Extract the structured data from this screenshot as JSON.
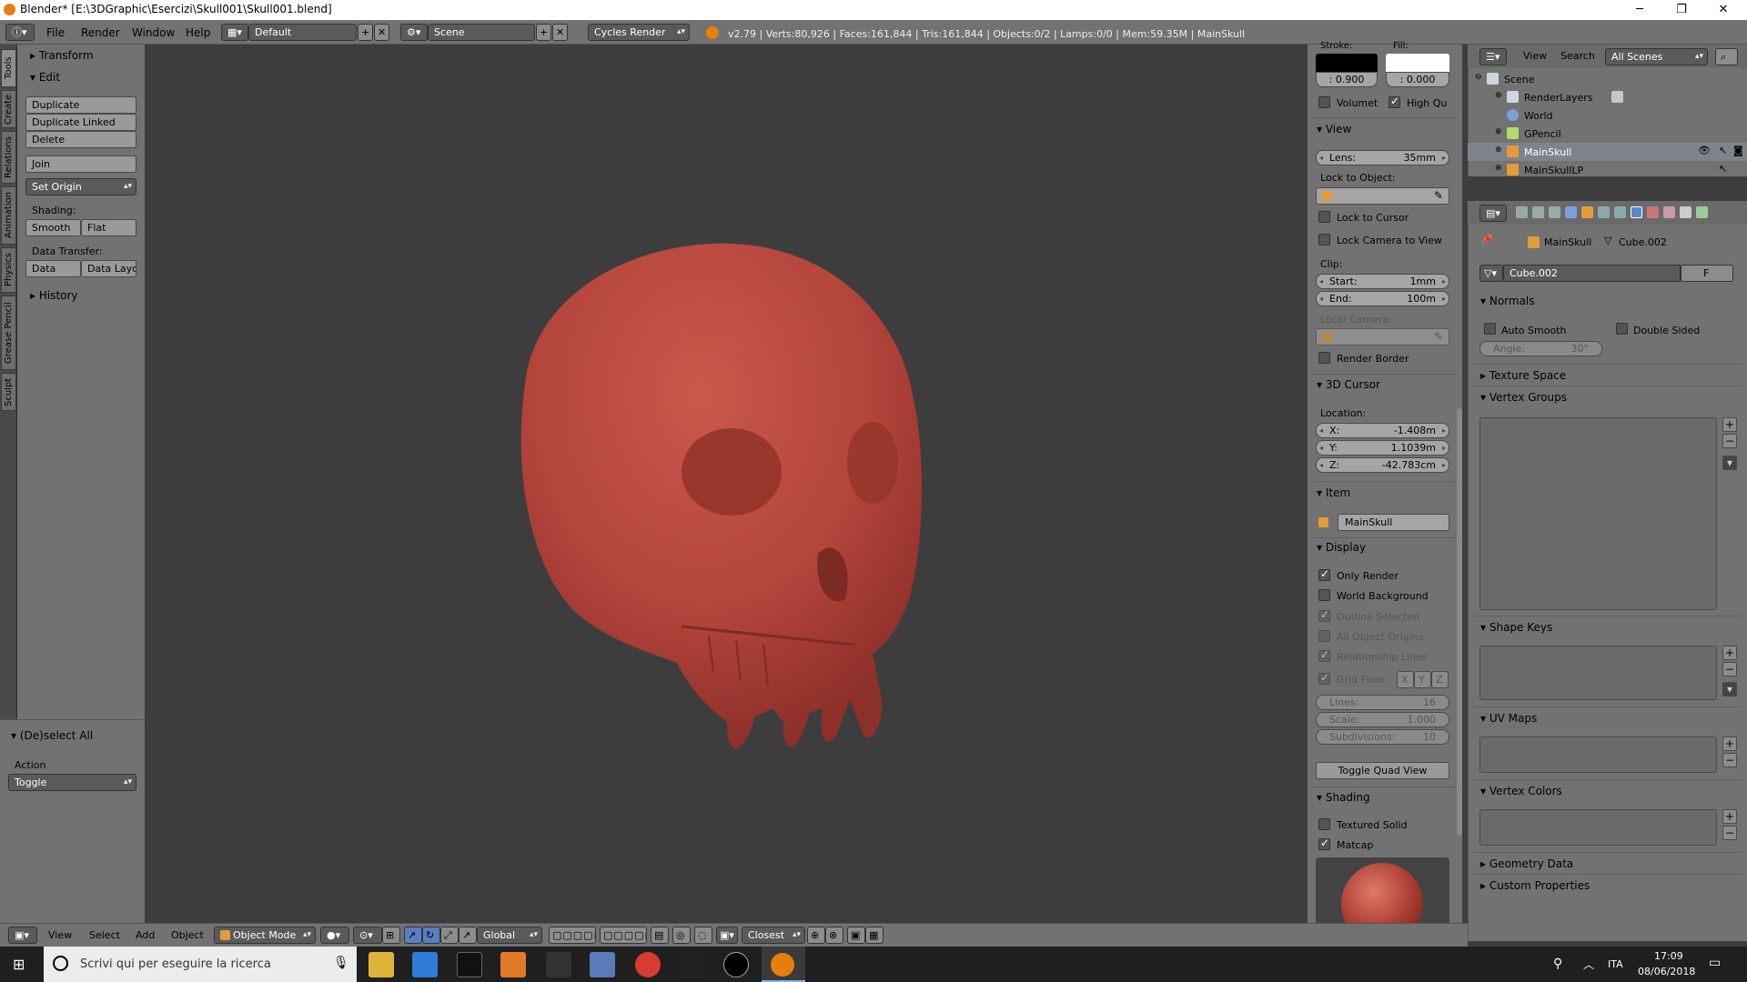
{
  "titlebar": {
    "title": "Blender* [E:\\3DGraphic\\Esercizi\\Skull001\\Skull001.blend]",
    "minimize": "─",
    "maximize": "❐",
    "close": "✕"
  },
  "menubar": {
    "items": [
      "File",
      "Render",
      "Window",
      "Help"
    ],
    "layout": "Default",
    "scene": "Scene",
    "engine": "Cycles Render",
    "stats": "v2.79 | Verts:80,926 | Faces:161,844 | Tris:161,844 | Objects:0/2 | Lamps:0/0 | Mem:59.35M | MainSkull"
  },
  "left_tabs": [
    "Tools",
    "Create",
    "Relations",
    "Animation",
    "Physics",
    "Grease Pencil",
    "Sculpt"
  ],
  "toolshelf": {
    "transform": "Transform",
    "edit": "Edit",
    "duplicate": "Duplicate",
    "duplicate_linked": "Duplicate Linked",
    "delete": "Delete",
    "join": "Join",
    "set_origin": "Set Origin",
    "shading_label": "Shading:",
    "smooth": "Smooth",
    "flat": "Flat",
    "data_transfer_label": "Data Transfer:",
    "data": "Data",
    "data_layo": "Data Layo",
    "history": "History"
  },
  "last_operator": {
    "title": "(De)select All",
    "action_label": "Action",
    "action_value": "Toggle"
  },
  "npanel": {
    "stroke_label": "Stroke:",
    "fill_label": "Fill:",
    "stroke_val": ": 0.900",
    "fill_val": ": 0.000",
    "volumet": "Volumet",
    "high_qu": "High Qu",
    "view": "View",
    "lens_label": "Lens:",
    "lens_val": "35mm",
    "lock_to_object": "Lock to Object:",
    "lock_to_cursor": "Lock to Cursor",
    "lock_camera": "Lock Camera to View",
    "clip": "Clip:",
    "start_label": "Start:",
    "start_val": "1mm",
    "end_label": "End:",
    "end_val": "100m",
    "local_camera": "Local Camera:",
    "render_border": "Render Border",
    "cursor_3d": "3D Cursor",
    "location": "Location:",
    "x_label": "X:",
    "x_val": "-1.408m",
    "y_label": "Y:",
    "y_val": "1.1039m",
    "z_label": "Z:",
    "z_val": "-42.783cm",
    "item": "Item",
    "item_name": "MainSkull",
    "display": "Display",
    "only_render": "Only Render",
    "world_background": "World Background",
    "outline_selected": "Outline Selected",
    "all_object_origins": "All Object Origins",
    "relationship_lines": "Relationship Lines",
    "grid_floor": "Grid Floor",
    "gx": "X",
    "gy": "Y",
    "gz": "Z",
    "lines_label": "Lines:",
    "lines_val": "16",
    "scale_label": "Scale:",
    "scale_val": "1.000",
    "subdiv_label": "Subdivisions:",
    "subdiv_val": "10",
    "toggle_quad": "Toggle Quad View",
    "shading": "Shading",
    "textured_solid": "Textured Solid",
    "matcap": "Matcap"
  },
  "outliner": {
    "view": "View",
    "search": "Search",
    "filter": "All Scenes",
    "items": [
      "Scene",
      "RenderLayers",
      "World",
      "GPencil",
      "MainSkull",
      "MainSkullLP"
    ]
  },
  "properties": {
    "breadcrumb_obj": "MainSkull",
    "breadcrumb_mesh": "Cube.002",
    "mesh_name": "Cube.002",
    "fake_user": "F",
    "normals": "Normals",
    "auto_smooth": "Auto Smooth",
    "double_sided": "Double Sided",
    "angle_label": "Angle:",
    "angle_val": "30°",
    "texture_space": "Texture Space",
    "vertex_groups": "Vertex Groups",
    "shape_keys": "Shape Keys",
    "uv_maps": "UV Maps",
    "vertex_colors": "Vertex Colors",
    "geometry_data": "Geometry Data",
    "custom_properties": "Custom Properties"
  },
  "viewport_header": {
    "view": "View",
    "select": "Select",
    "add": "Add",
    "object": "Object",
    "mode": "Object Mode",
    "orientation": "Global",
    "snap": "Closest"
  },
  "taskbar": {
    "search_placeholder": "Scrivi qui per eseguire la ricerca",
    "lang": "ITA",
    "time": "17:09",
    "date": "08/06/2018"
  },
  "colors": {
    "skull": "#b4453b",
    "ui_bg": "#727272",
    "viewport": "#3d3d3d"
  }
}
